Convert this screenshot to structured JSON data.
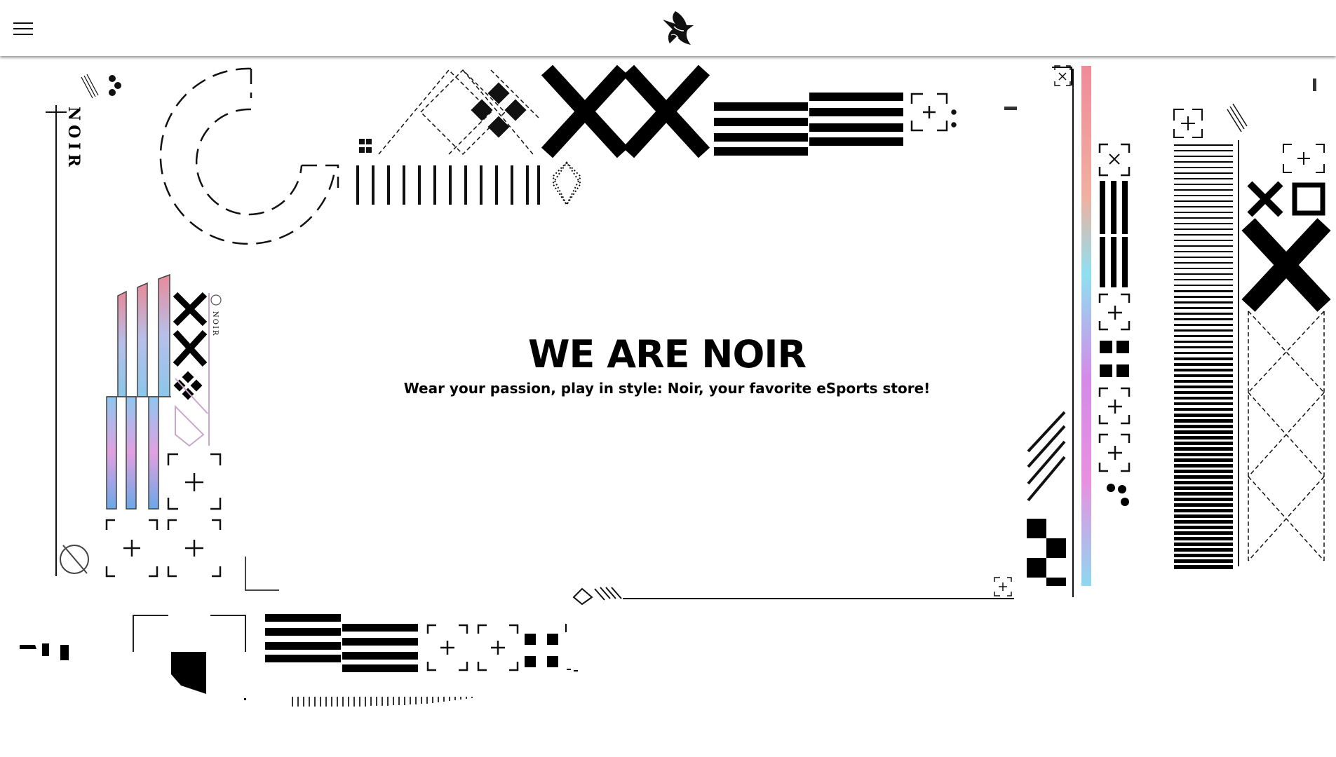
{
  "header": {
    "menu_icon": "hamburger-menu-icon",
    "logo_icon": "duck-logo-icon"
  },
  "hero": {
    "title": "WE ARE NOIR",
    "subtitle": "Wear your passion, play in style: Noir, your favorite eSports store!"
  },
  "decor": {
    "brand_vertical": "NOIR",
    "brand_small": "NOIR"
  },
  "colors": {
    "ink": "#000000",
    "gradient_pink": "#e8a0c0",
    "gradient_blue": "#8ec7f0",
    "gradient_violet": "#d48ae8"
  }
}
